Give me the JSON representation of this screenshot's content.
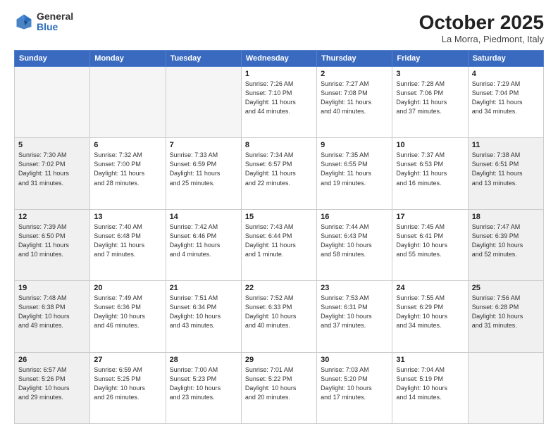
{
  "logo": {
    "general": "General",
    "blue": "Blue"
  },
  "header": {
    "title": "October 2025",
    "subtitle": "La Morra, Piedmont, Italy"
  },
  "weekdays": [
    "Sunday",
    "Monday",
    "Tuesday",
    "Wednesday",
    "Thursday",
    "Friday",
    "Saturday"
  ],
  "rows": [
    [
      {
        "day": "",
        "info": "",
        "empty": true
      },
      {
        "day": "",
        "info": "",
        "empty": true
      },
      {
        "day": "",
        "info": "",
        "empty": true
      },
      {
        "day": "1",
        "info": "Sunrise: 7:26 AM\nSunset: 7:10 PM\nDaylight: 11 hours\nand 44 minutes."
      },
      {
        "day": "2",
        "info": "Sunrise: 7:27 AM\nSunset: 7:08 PM\nDaylight: 11 hours\nand 40 minutes."
      },
      {
        "day": "3",
        "info": "Sunrise: 7:28 AM\nSunset: 7:06 PM\nDaylight: 11 hours\nand 37 minutes."
      },
      {
        "day": "4",
        "info": "Sunrise: 7:29 AM\nSunset: 7:04 PM\nDaylight: 11 hours\nand 34 minutes."
      }
    ],
    [
      {
        "day": "5",
        "info": "Sunrise: 7:30 AM\nSunset: 7:02 PM\nDaylight: 11 hours\nand 31 minutes.",
        "shaded": true
      },
      {
        "day": "6",
        "info": "Sunrise: 7:32 AM\nSunset: 7:00 PM\nDaylight: 11 hours\nand 28 minutes."
      },
      {
        "day": "7",
        "info": "Sunrise: 7:33 AM\nSunset: 6:59 PM\nDaylight: 11 hours\nand 25 minutes."
      },
      {
        "day": "8",
        "info": "Sunrise: 7:34 AM\nSunset: 6:57 PM\nDaylight: 11 hours\nand 22 minutes."
      },
      {
        "day": "9",
        "info": "Sunrise: 7:35 AM\nSunset: 6:55 PM\nDaylight: 11 hours\nand 19 minutes."
      },
      {
        "day": "10",
        "info": "Sunrise: 7:37 AM\nSunset: 6:53 PM\nDaylight: 11 hours\nand 16 minutes."
      },
      {
        "day": "11",
        "info": "Sunrise: 7:38 AM\nSunset: 6:51 PM\nDaylight: 11 hours\nand 13 minutes.",
        "shaded": true
      }
    ],
    [
      {
        "day": "12",
        "info": "Sunrise: 7:39 AM\nSunset: 6:50 PM\nDaylight: 11 hours\nand 10 minutes.",
        "shaded": true
      },
      {
        "day": "13",
        "info": "Sunrise: 7:40 AM\nSunset: 6:48 PM\nDaylight: 11 hours\nand 7 minutes."
      },
      {
        "day": "14",
        "info": "Sunrise: 7:42 AM\nSunset: 6:46 PM\nDaylight: 11 hours\nand 4 minutes."
      },
      {
        "day": "15",
        "info": "Sunrise: 7:43 AM\nSunset: 6:44 PM\nDaylight: 11 hours\nand 1 minute."
      },
      {
        "day": "16",
        "info": "Sunrise: 7:44 AM\nSunset: 6:43 PM\nDaylight: 10 hours\nand 58 minutes."
      },
      {
        "day": "17",
        "info": "Sunrise: 7:45 AM\nSunset: 6:41 PM\nDaylight: 10 hours\nand 55 minutes."
      },
      {
        "day": "18",
        "info": "Sunrise: 7:47 AM\nSunset: 6:39 PM\nDaylight: 10 hours\nand 52 minutes.",
        "shaded": true
      }
    ],
    [
      {
        "day": "19",
        "info": "Sunrise: 7:48 AM\nSunset: 6:38 PM\nDaylight: 10 hours\nand 49 minutes.",
        "shaded": true
      },
      {
        "day": "20",
        "info": "Sunrise: 7:49 AM\nSunset: 6:36 PM\nDaylight: 10 hours\nand 46 minutes."
      },
      {
        "day": "21",
        "info": "Sunrise: 7:51 AM\nSunset: 6:34 PM\nDaylight: 10 hours\nand 43 minutes."
      },
      {
        "day": "22",
        "info": "Sunrise: 7:52 AM\nSunset: 6:33 PM\nDaylight: 10 hours\nand 40 minutes."
      },
      {
        "day": "23",
        "info": "Sunrise: 7:53 AM\nSunset: 6:31 PM\nDaylight: 10 hours\nand 37 minutes."
      },
      {
        "day": "24",
        "info": "Sunrise: 7:55 AM\nSunset: 6:29 PM\nDaylight: 10 hours\nand 34 minutes."
      },
      {
        "day": "25",
        "info": "Sunrise: 7:56 AM\nSunset: 6:28 PM\nDaylight: 10 hours\nand 31 minutes.",
        "shaded": true
      }
    ],
    [
      {
        "day": "26",
        "info": "Sunrise: 6:57 AM\nSunset: 5:26 PM\nDaylight: 10 hours\nand 29 minutes.",
        "shaded": true
      },
      {
        "day": "27",
        "info": "Sunrise: 6:59 AM\nSunset: 5:25 PM\nDaylight: 10 hours\nand 26 minutes."
      },
      {
        "day": "28",
        "info": "Sunrise: 7:00 AM\nSunset: 5:23 PM\nDaylight: 10 hours\nand 23 minutes."
      },
      {
        "day": "29",
        "info": "Sunrise: 7:01 AM\nSunset: 5:22 PM\nDaylight: 10 hours\nand 20 minutes."
      },
      {
        "day": "30",
        "info": "Sunrise: 7:03 AM\nSunset: 5:20 PM\nDaylight: 10 hours\nand 17 minutes."
      },
      {
        "day": "31",
        "info": "Sunrise: 7:04 AM\nSunset: 5:19 PM\nDaylight: 10 hours\nand 14 minutes."
      },
      {
        "day": "",
        "info": "",
        "empty": true
      }
    ]
  ]
}
